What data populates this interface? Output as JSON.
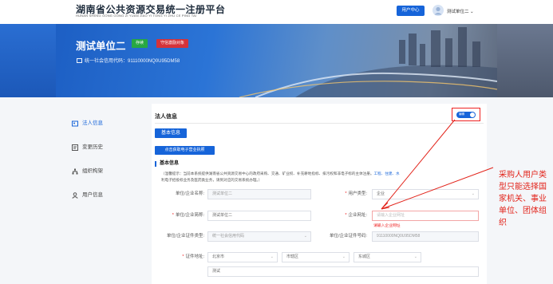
{
  "header": {
    "title": "湖南省公共资源交易统一注册平台",
    "subtitle": "HUNAN SHENG GONG GONG ZI YUAN JIAO YI TONG YI ZHU CE PING TAI",
    "user_center": "用户中心",
    "username": "测试单位二 ⌄"
  },
  "banner": {
    "unit_name": "测试单位二",
    "tag_status": "存续",
    "tag_action": "守信激励对象",
    "credit_code": "统一社会信用代码：91110000NQ0U95DM58"
  },
  "sidebar": {
    "items": [
      {
        "label": "法人信息",
        "icon": "person-card-icon"
      },
      {
        "label": "变更历史",
        "icon": "history-icon"
      },
      {
        "label": "组织构架",
        "icon": "org-structure-icon"
      },
      {
        "label": "用户信息",
        "icon": "user-icon"
      }
    ]
  },
  "content": {
    "section_title": "法人信息",
    "toggle_label": "编辑",
    "tab_basic": "基本信息",
    "license_button": "点击获取电子营业执照",
    "sub_title": "基本信息",
    "notice_1": "（温馨提示：当前本系统提供湖南省公共资源交易中心的政府采购、交通、矿业权、补充耕地指标、排污权和非电子标的主体注册。",
    "notice_links": "工程、住建、水",
    "notice_2": "利电子招投标业务及医药类业务，请到对应的交易系统办理。）",
    "fields": {
      "unit_name_label": "单位/企业名称:",
      "unit_name_value": "测试单位二",
      "user_type_label": "用户类型:",
      "user_type_value": "企业",
      "short_name_label": "单位/企业简称:",
      "short_name_value": "测试单位二",
      "website_label": "企业网址:",
      "website_placeholder": "请输入企业网址",
      "website_error": "请输入企业网址",
      "cert_type_label": "单位/企业证件类型:",
      "cert_type_value": "统一社会信用代码",
      "cert_no_label": "单位/企业证件号码:",
      "cert_no_value": "91110000NQ0U95DM58",
      "address_label": "证件地址:",
      "province": "北京市",
      "city": "市辖区",
      "district": "东城区",
      "address_detail": "测试"
    }
  },
  "annotation": {
    "text": "采购人用户类型只能选择国家机关、事业单位、团体组织"
  }
}
